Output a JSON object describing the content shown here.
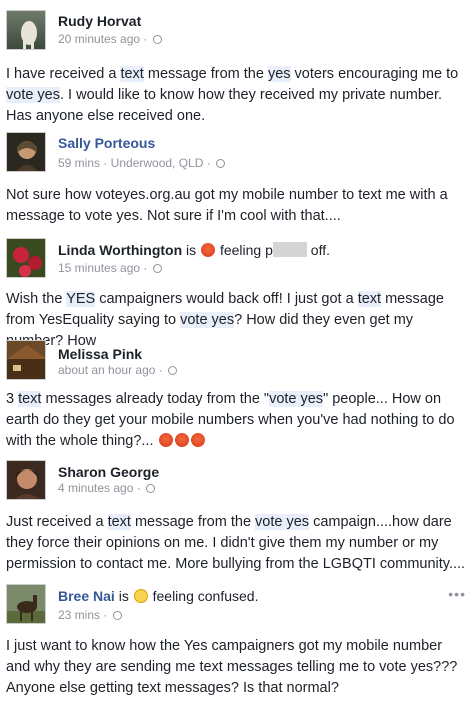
{
  "posts": [
    {
      "name": "Rudy Horvat",
      "meta": "20 minutes ago ·",
      "text_parts": [
        "I have received a ",
        "text",
        " message from the ",
        "yes",
        " voters encouraging me to ",
        "vote yes",
        ". I would like to know how they received my private number. Has anyone else received one."
      ]
    },
    {
      "name": "Sally Porteous",
      "meta": "59 mins · Underwood, QLD ·",
      "text_parts": [
        "Not sure how voteyes.org.au got my mobile number to text me with a message to vote yes. Not sure if I'm cool with that...."
      ]
    },
    {
      "name": "Linda Worthington",
      "is": "is",
      "feeling": "feeling",
      "feeling_partial": "p",
      "feeling_end": "off.",
      "meta": "15 minutes ago ·",
      "text_parts": [
        "Wish the ",
        "YES",
        " campaigners would back off! I just got a ",
        "text",
        " message from YesEquality saying to ",
        "vote yes",
        "? How did they even get my number? How"
      ]
    },
    {
      "name": "Melissa Pink",
      "meta": "about an hour ago ·",
      "text_parts": [
        "3 ",
        "text",
        " messages already today from the \"",
        "vote yes",
        "\" people... How on earth do they get your mobile numbers when you've had nothing to do with the whole thing?..."
      ]
    },
    {
      "name": "Sharon George",
      "meta": "4 minutes ago ·",
      "text_parts": [
        "Just received a ",
        "text",
        " message from the ",
        "vote yes",
        " campaign....how dare they force their opinions on me. I didn't give them my number or my permission to contact me. More bullying from the LGBQTI community...."
      ]
    },
    {
      "name": "Bree Nai",
      "is": "is",
      "feeling": "feeling confused.",
      "meta": "23 mins ·",
      "more": "•••",
      "text_parts": [
        "I just want to know how the Yes campaigners got my mobile number and why they are sending me text messages telling me to vote yes??? Anyone else getting text messages? Is that normal?"
      ]
    }
  ],
  "colors": {
    "link": "#365899",
    "meta": "#90949c",
    "highlight": "#e8eefa"
  }
}
